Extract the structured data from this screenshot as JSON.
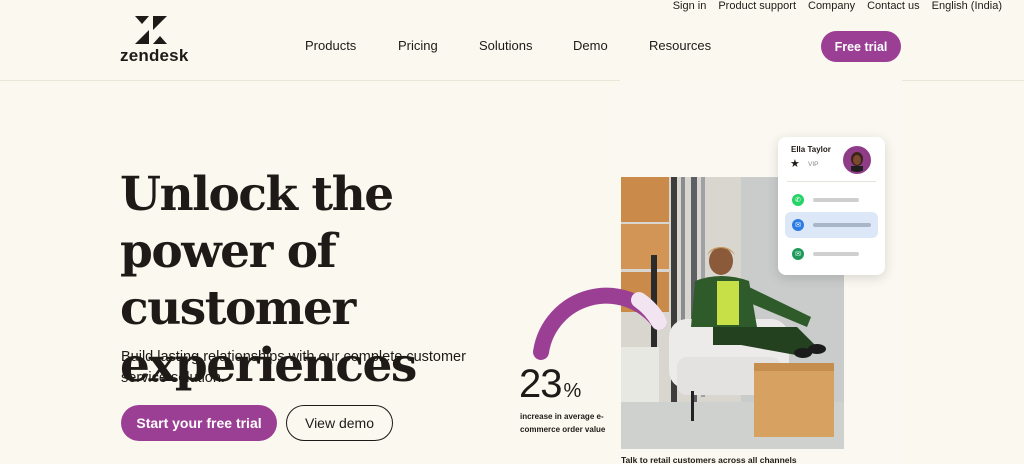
{
  "header": {
    "utility_links": [
      "Sign in",
      "Product support",
      "Company",
      "Contact us",
      "English (India)"
    ],
    "logo_text": "zendesk",
    "nav": [
      "Products",
      "Pricing",
      "Solutions",
      "Demo",
      "Resources"
    ],
    "cta_label": "Free trial"
  },
  "hero": {
    "title": "Unlock the power of customer experiences",
    "subtitle": "Build lasting relationships with our complete customer service solution.",
    "primary_button": "Start your free trial",
    "secondary_button": "View demo"
  },
  "visual": {
    "stat_value": "23",
    "stat_unit": "%",
    "stat_label": "increase in average e-commerce order value",
    "caption": "Talk to retail customers across all channels",
    "card": {
      "name": "Ella Taylor",
      "tier": "VIP",
      "channels": [
        "whatsapp-icon",
        "messenger-icon",
        "email-icon"
      ]
    }
  },
  "colors": {
    "brand_purple": "#9b3f95",
    "background": "#fbf8f0",
    "text": "#1f1a17",
    "whatsapp": "#25d366",
    "messenger": "#2d7be5",
    "email": "#1f9a5b"
  }
}
